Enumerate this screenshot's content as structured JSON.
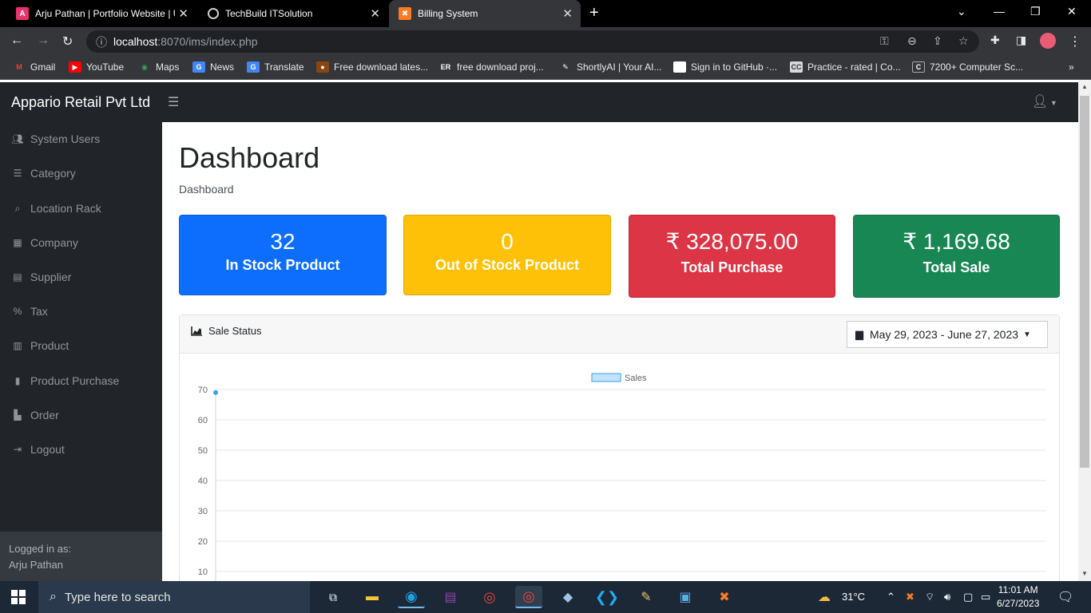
{
  "browser": {
    "tabs": [
      {
        "title": "Arju Pathan | Portfolio Website | U",
        "icon": "portfolio-icon"
      },
      {
        "title": "TechBuild ITSolution",
        "icon": "globe-icon"
      },
      {
        "title": "Billing System",
        "icon": "xampp-icon"
      }
    ],
    "url_host": "localhost",
    "url_rest": ":8070/ims/index.php",
    "bookmarks": [
      "Gmail",
      "YouTube",
      "Maps",
      "News",
      "Translate",
      "Free download lates...",
      "free download proj...",
      "ShortlyAI | Your AI...",
      "Sign in to GitHub ·...",
      "Practice - rated | Co...",
      "7200+ Computer Sc..."
    ]
  },
  "app": {
    "brand": "Appario Retail Pvt Ltd",
    "sidebar": [
      {
        "label": "System Users",
        "icon": "users-icon"
      },
      {
        "label": "Category",
        "icon": "list-icon"
      },
      {
        "label": "Location Rack",
        "icon": "search-location-icon"
      },
      {
        "label": "Company",
        "icon": "building-icon"
      },
      {
        "label": "Supplier",
        "icon": "building-icon"
      },
      {
        "label": "Tax",
        "icon": "percent-icon"
      },
      {
        "label": "Product",
        "icon": "barcode-icon"
      },
      {
        "label": "Product Purchase",
        "icon": "clipboard-icon"
      },
      {
        "label": "Order",
        "icon": "cash-register-icon"
      },
      {
        "label": "Logout",
        "icon": "sign-out-icon"
      }
    ],
    "footer": {
      "label": "Logged in as:",
      "user": "Arju Pathan"
    },
    "page_title": "Dashboard",
    "breadcrumb": "Dashboard",
    "cards": [
      {
        "value": "32",
        "label": "In Stock Product",
        "color": "#0d6efd"
      },
      {
        "value": "0",
        "label": "Out of Stock Product",
        "color": "#ffc107"
      },
      {
        "value": "₹ 328,075.00",
        "label": "Total Purchase",
        "color": "#dc3545"
      },
      {
        "value": "₹ 1,169.68",
        "label": "Total Sale",
        "color": "#198754"
      }
    ],
    "chart_panel": {
      "title": "Sale Status",
      "date_range": "May 29, 2023 - June 27, 2023"
    }
  },
  "chart_data": {
    "type": "line",
    "series": [
      {
        "name": "Sales",
        "values": [
          69
        ]
      }
    ],
    "y_ticks": [
      10,
      20,
      30,
      40,
      50,
      60,
      70
    ],
    "ylim": [
      0,
      70
    ],
    "legend_position": "top-center",
    "grid": true
  },
  "taskbar": {
    "search_placeholder": "Type here to search",
    "weather": "31°C",
    "time": "11:01 AM",
    "date": "6/27/2023"
  }
}
